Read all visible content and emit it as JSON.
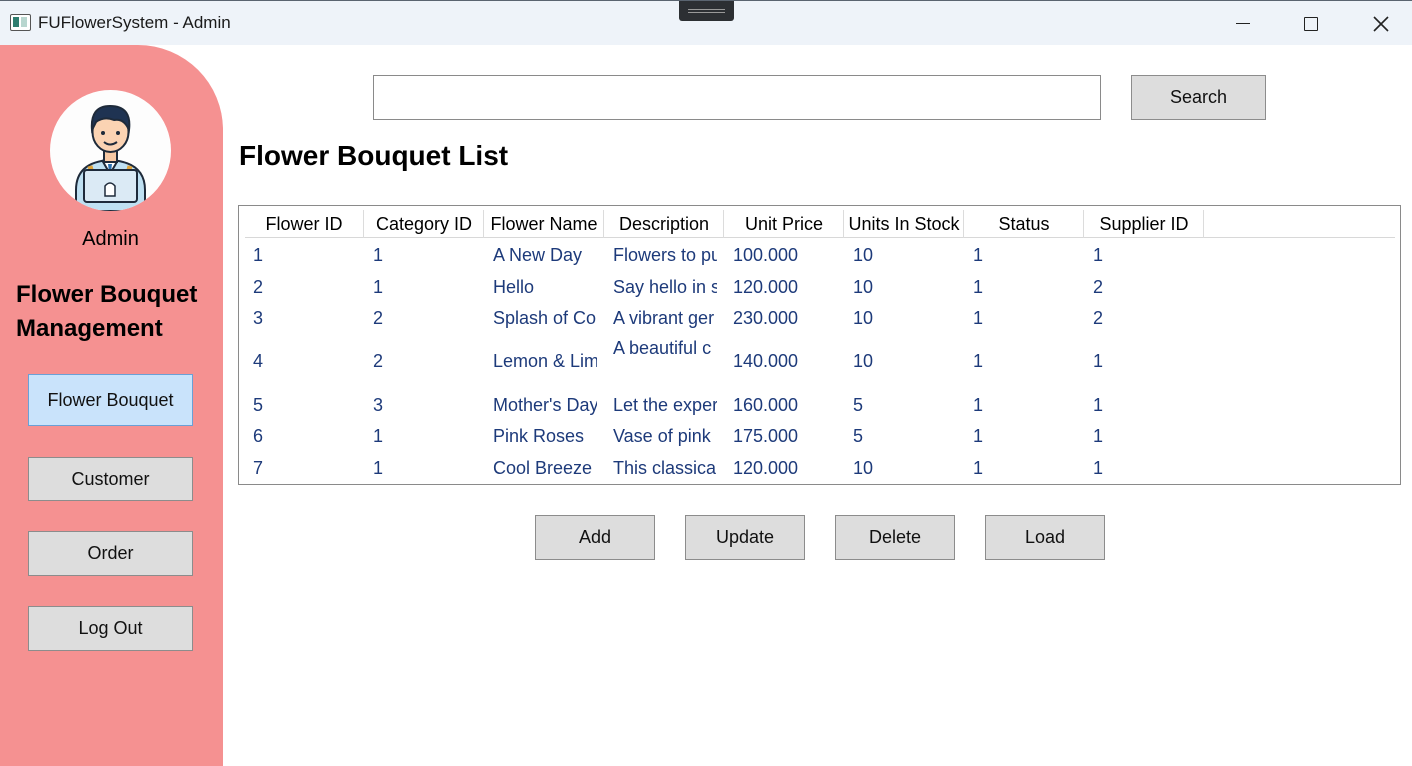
{
  "window": {
    "title": "FUFlowerSystem - Admin"
  },
  "sidebar": {
    "user_label": "Admin",
    "section_title": "Flower Bouquet Management",
    "nav": [
      {
        "label": "Flower Bouquet",
        "active": true
      },
      {
        "label": "Customer",
        "active": false
      },
      {
        "label": "Order",
        "active": false
      },
      {
        "label": "Log Out",
        "active": false
      }
    ]
  },
  "search": {
    "value": "",
    "button_label": "Search"
  },
  "main": {
    "title": "Flower Bouquet List"
  },
  "table": {
    "columns": [
      "Flower ID",
      "Category ID",
      "Flower Name",
      "Description",
      "Unit Price",
      "Units In Stock",
      "Status",
      "Supplier ID"
    ],
    "rows": [
      {
        "flower_id": "1",
        "category_id": "1",
        "flower_name": "A New Day",
        "description": "Flowers to pu",
        "unit_price": "100.000",
        "units_in_stock": "10",
        "status": "1",
        "supplier_id": "1"
      },
      {
        "flower_id": "2",
        "category_id": "1",
        "flower_name": "Hello",
        "description": "Say hello in s",
        "unit_price": "120.000",
        "units_in_stock": "10",
        "status": "1",
        "supplier_id": "2"
      },
      {
        "flower_id": "3",
        "category_id": "2",
        "flower_name": "Splash of Col",
        "description": "A vibrant ger",
        "unit_price": "230.000",
        "units_in_stock": "10",
        "status": "1",
        "supplier_id": "2"
      },
      {
        "flower_id": "4",
        "category_id": "2",
        "flower_name": "Lemon & Lim",
        "description": "A beautiful c",
        "unit_price": "140.000",
        "units_in_stock": "10",
        "status": "1",
        "supplier_id": "1"
      },
      {
        "flower_id": "5",
        "category_id": "3",
        "flower_name": "Mother's Day",
        "description": "Let the exper",
        "unit_price": "160.000",
        "units_in_stock": "5",
        "status": "1",
        "supplier_id": "1"
      },
      {
        "flower_id": "6",
        "category_id": "1",
        "flower_name": "Pink Roses",
        "description": "Vase of pink",
        "unit_price": "175.000",
        "units_in_stock": "5",
        "status": "1",
        "supplier_id": "1"
      },
      {
        "flower_id": "7",
        "category_id": "1",
        "flower_name": "Cool Breeze",
        "description": "This classical",
        "unit_price": "120.000",
        "units_in_stock": "10",
        "status": "1",
        "supplier_id": "1"
      }
    ]
  },
  "actions": {
    "add_label": "Add",
    "update_label": "Update",
    "delete_label": "Delete",
    "load_label": "Load"
  },
  "colors": {
    "sidebar_bg": "#f59191",
    "active_nav_bg": "#c9e3fb",
    "button_bg": "#dddddd",
    "cell_text": "#1d3a7a"
  }
}
